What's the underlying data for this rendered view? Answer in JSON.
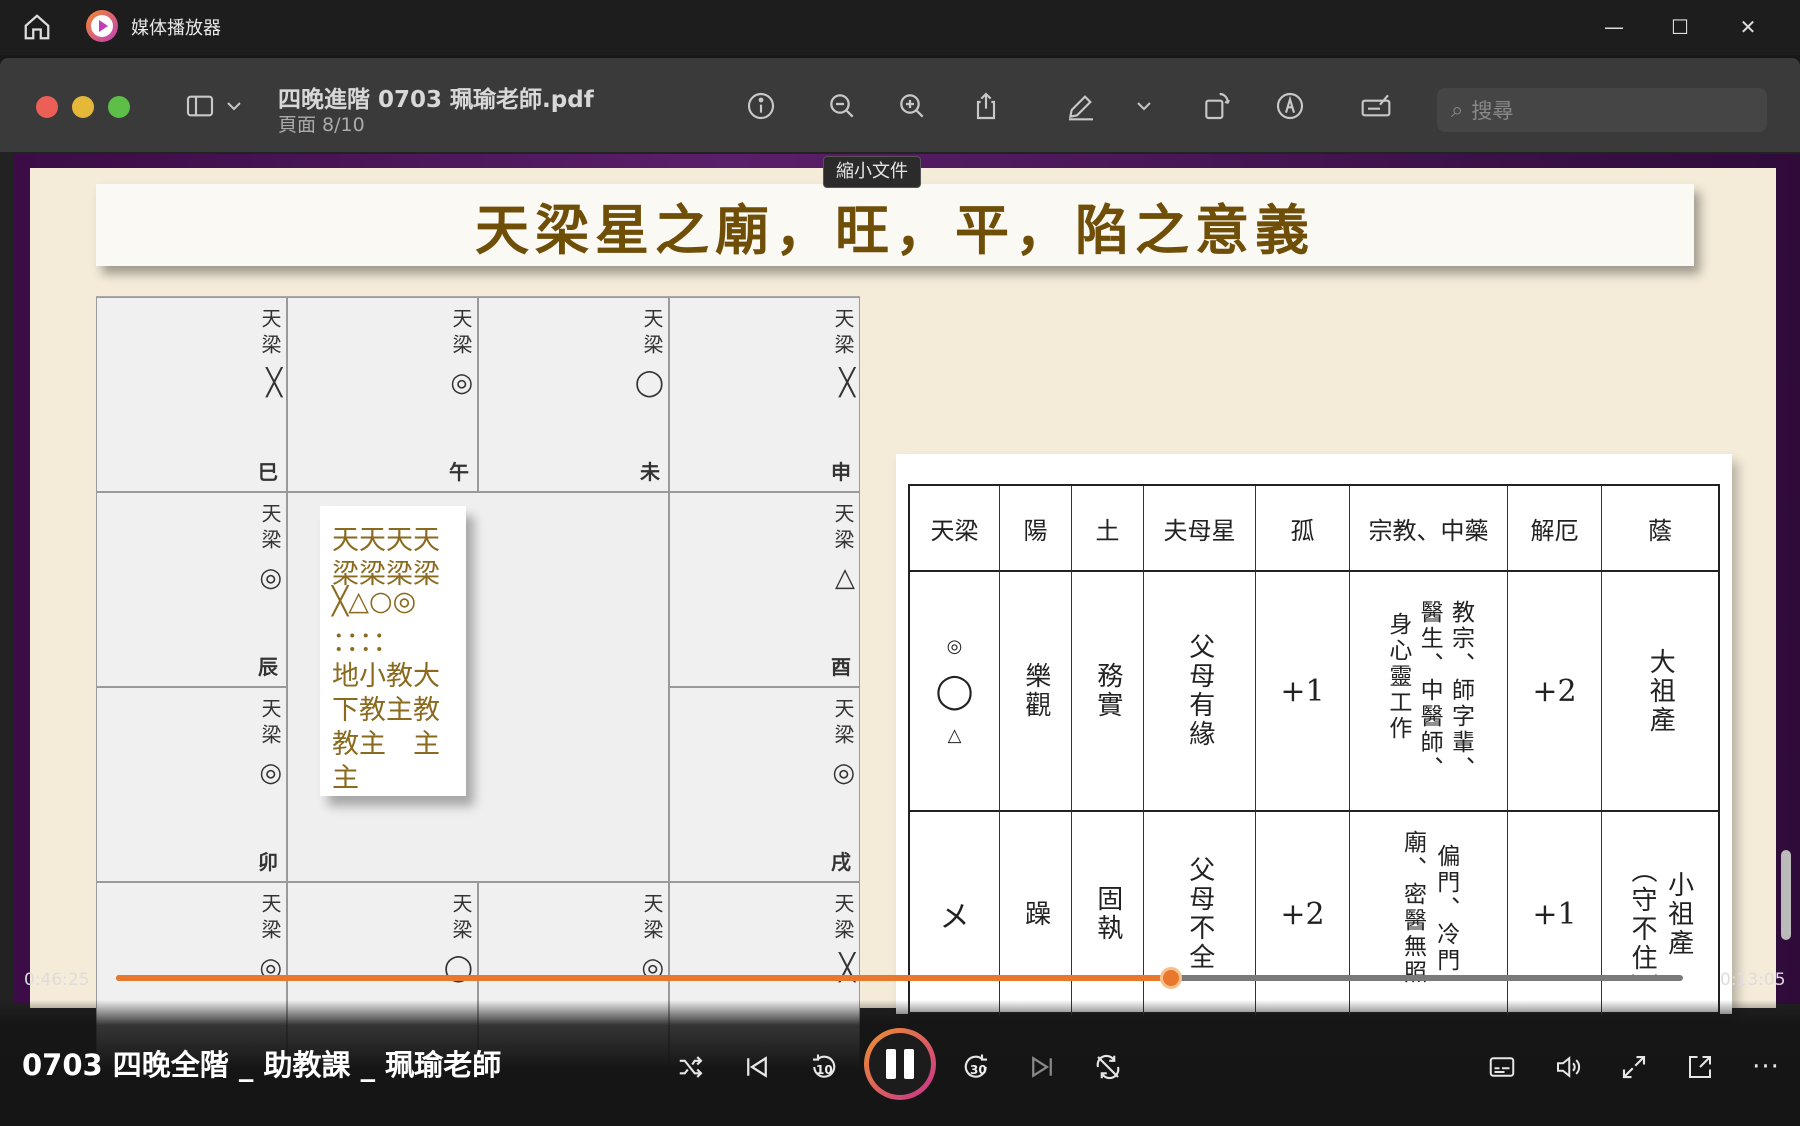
{
  "window": {
    "app_title": "媒体播放器",
    "controls": {
      "minimize": "—",
      "maximize": "☐",
      "close": "✕"
    }
  },
  "preview": {
    "doc_title": "四晚進階 0703 珮瑜老師.pdf",
    "page_info": "頁面 8/10",
    "search_placeholder": "搜尋",
    "tooltip": "縮小文件"
  },
  "slide": {
    "banner": "天梁星之廟，旺，平，陷之意義",
    "grid_cells": [
      {
        "star": "天梁",
        "mark": "╳",
        "branch": "巳"
      },
      {
        "star": "天梁",
        "mark": "◎",
        "branch": "午"
      },
      {
        "star": "天梁",
        "mark": "◯",
        "branch": "未"
      },
      {
        "star": "天梁",
        "mark": "╳",
        "branch": "申"
      },
      {
        "star": "天梁",
        "mark": "◎",
        "branch": "辰"
      },
      {
        "star": "天梁",
        "mark": "△",
        "branch": "酉"
      },
      {
        "star": "天梁",
        "mark": "◎",
        "branch": "卯"
      },
      {
        "star": "天梁",
        "mark": "◎",
        "branch": "戌"
      },
      {
        "star": "天梁",
        "mark": "◎",
        "branch": ""
      },
      {
        "star": "天梁",
        "mark": "◯",
        "branch": ""
      },
      {
        "star": "天梁",
        "mark": "◎",
        "branch": ""
      },
      {
        "star": "天梁",
        "mark": "╳",
        "branch": ""
      }
    ],
    "note_lines": [
      "天天天天",
      "梁梁梁梁",
      "╳△○◎",
      "：：：：",
      "地小教大",
      "下教主教",
      "教主　主",
      "主"
    ],
    "table": {
      "headers": [
        "天梁",
        "陽",
        "土",
        "夫母星",
        "孤",
        "宗教、中藥",
        "解厄",
        "蔭"
      ],
      "row1": {
        "marks": [
          "◎",
          "◯",
          "△"
        ],
        "c1": "樂觀",
        "c2": "務實",
        "c3": "父母有緣",
        "c4": "+1",
        "c5a": "教宗、師字輩、",
        "c5b": "醫生、中醫師、",
        "c5c": "身心靈工作",
        "c6": "+2",
        "c7": "大祖產"
      },
      "row2": {
        "mark": "メ",
        "c1": "躁",
        "c2": "固執",
        "c3": "父母不全",
        "c4": "+2",
        "c5a": "偏門、冷門",
        "c5b": "廟、密醫無照",
        "c6": "+1",
        "c7a": "小祖產",
        "c7b": "（守不住）"
      }
    }
  },
  "player": {
    "elapsed": "0:46:25",
    "remaining": "0:13:05",
    "progress_fraction": 0.673,
    "media_title": "0703 四晚全階 _ 助教課 _ 珮瑜老師",
    "skip_back_label": "10",
    "skip_forward_label": "30"
  },
  "icons": {
    "home": "home-icon",
    "app": "media-player-icon",
    "sidebar": "sidebar-icon",
    "info": "info-icon",
    "zoom_out": "zoom-out-icon",
    "zoom_in": "zoom-in-icon",
    "share": "share-icon",
    "markup": "pen-icon",
    "rotate": "rotate-icon",
    "annotate": "annotate-icon",
    "sign": "signature-icon",
    "search": "search-icon"
  },
  "colors": {
    "accent": "#e8782d",
    "accent2": "#c7318e",
    "banner_text": "#6f4e08"
  }
}
